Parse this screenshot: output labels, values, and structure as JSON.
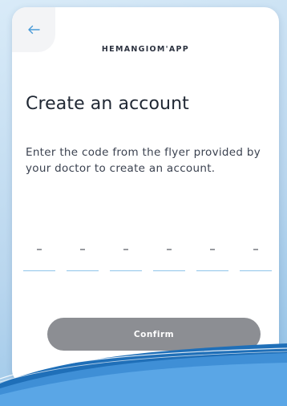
{
  "app": {
    "brand_name": "HEMANGIOM'APP"
  },
  "header": {
    "back_icon": "arrow-left-icon"
  },
  "main": {
    "title": "Create an account",
    "instructions": "Enter the code from the flyer provided by your doctor to create an account.",
    "code_fields": [
      {
        "value": "",
        "placeholder": "–"
      },
      {
        "value": "",
        "placeholder": "–"
      },
      {
        "value": "",
        "placeholder": "–"
      },
      {
        "value": "",
        "placeholder": "–"
      },
      {
        "value": "",
        "placeholder": "–"
      },
      {
        "value": "",
        "placeholder": "–"
      }
    ],
    "confirm_label": "Confirm"
  },
  "colors": {
    "accent": "#4a9bd8",
    "underline": "#8fc4ea",
    "button_disabled": "#8c8e93",
    "background": "#ffffff"
  }
}
